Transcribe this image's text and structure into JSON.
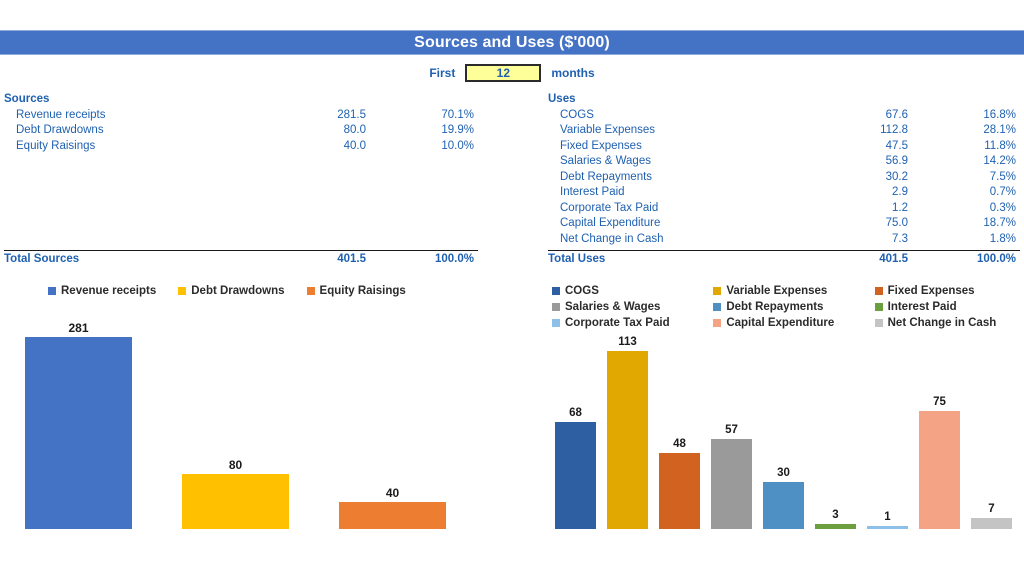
{
  "header": {
    "title": "Sources and Uses ($'000)",
    "bar_color": "#4472c4"
  },
  "controls": {
    "prefix_label": "First",
    "period_value": "12",
    "suffix_label": "months"
  },
  "sources_table": {
    "header_label": "Sources",
    "rows": [
      {
        "name": "Revenue receipts",
        "value": "281.5",
        "pct": "70.1%"
      },
      {
        "name": "Debt Drawdowns",
        "value": "80.0",
        "pct": "19.9%"
      },
      {
        "name": "Equity Raisings",
        "value": "40.0",
        "pct": "10.0%"
      }
    ],
    "total": {
      "name": "Total Sources",
      "value": "401.5",
      "pct": "100.0%"
    }
  },
  "uses_table": {
    "header_label": "Uses",
    "rows": [
      {
        "name": "COGS",
        "value": "67.6",
        "pct": "16.8%"
      },
      {
        "name": "Variable Expenses",
        "value": "112.8",
        "pct": "28.1%"
      },
      {
        "name": "Fixed Expenses",
        "value": "47.5",
        "pct": "11.8%"
      },
      {
        "name": "Salaries & Wages",
        "value": "56.9",
        "pct": "14.2%"
      },
      {
        "name": "Debt Repayments",
        "value": "30.2",
        "pct": "7.5%"
      },
      {
        "name": "Interest Paid",
        "value": "2.9",
        "pct": "0.7%"
      },
      {
        "name": "Corporate Tax Paid",
        "value": "1.2",
        "pct": "0.3%"
      },
      {
        "name": "Capital Expenditure",
        "value": "75.0",
        "pct": "18.7%"
      },
      {
        "name": "Net Change in Cash",
        "value": "7.3",
        "pct": "1.8%"
      }
    ],
    "total": {
      "name": "Total Uses",
      "value": "401.5",
      "pct": "100.0%"
    }
  },
  "chart_data": [
    {
      "id": "sources-chart",
      "type": "bar",
      "title": "",
      "xlabel": "",
      "ylabel": "",
      "ylim": [
        0,
        300
      ],
      "grid": false,
      "legend_position": "top",
      "categories": [
        "Revenue receipts",
        "Debt Drawdowns",
        "Equity Raisings"
      ],
      "values": [
        281,
        80,
        40
      ],
      "data_labels": [
        "281",
        "80",
        "40"
      ],
      "colors": [
        "#4472c4",
        "#ffc000",
        "#ed7d31"
      ]
    },
    {
      "id": "uses-chart",
      "type": "bar",
      "title": "",
      "xlabel": "",
      "ylabel": "",
      "ylim": [
        0,
        120
      ],
      "grid": false,
      "legend_position": "top",
      "categories": [
        "COGS",
        "Variable Expenses",
        "Fixed Expenses",
        "Salaries & Wages",
        "Debt Repayments",
        "Interest Paid",
        "Corporate Tax Paid",
        "Capital Expenditure",
        "Net Change in Cash"
      ],
      "values": [
        68,
        113,
        48,
        57,
        30,
        3,
        1,
        75,
        7
      ],
      "data_labels": [
        "68",
        "113",
        "48",
        "57",
        "30",
        "3",
        "1",
        "75",
        "7"
      ],
      "colors": [
        "#2e5fa3",
        "#e0a800",
        "#d2621f",
        "#9a9a9a",
        "#4e8fc4",
        "#6b9e3f",
        "#8cc0e8",
        "#f4a384",
        "#c4c4c4"
      ]
    }
  ]
}
